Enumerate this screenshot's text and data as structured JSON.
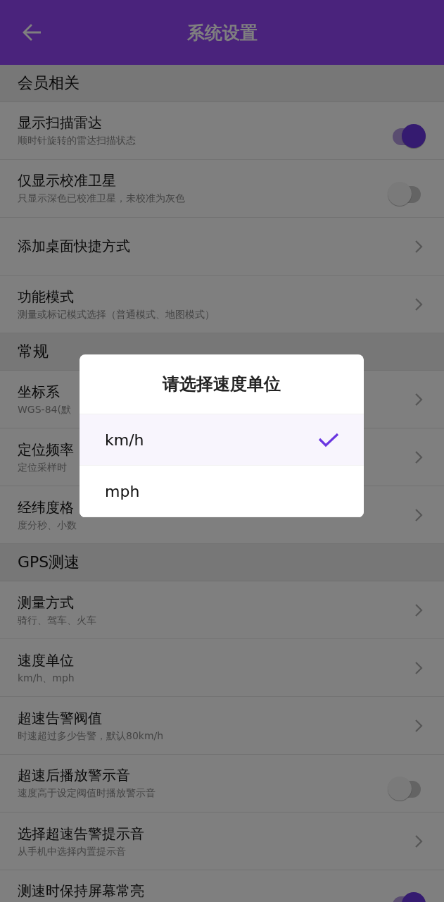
{
  "header": {
    "title": "系统设置"
  },
  "sections": [
    {
      "title": "会员相关",
      "items": [
        {
          "kind": "toggle",
          "title": "显示扫描雷达",
          "subtitle": "顺时针旋转的雷达扫描状态",
          "on": true
        },
        {
          "kind": "toggle",
          "title": "仅显示校准卫星",
          "subtitle": "只显示深色已校准卫星，未校准为灰色",
          "on": false
        },
        {
          "kind": "link",
          "title": "添加桌面快捷方式"
        },
        {
          "kind": "link",
          "title": "功能模式",
          "subtitle": "测量或标记模式选择（普通模式、地图模式）"
        }
      ]
    },
    {
      "title": "常规",
      "items": [
        {
          "kind": "link",
          "title": "坐标系",
          "subtitle": "WGS-84(默"
        },
        {
          "kind": "link",
          "title": "定位频率",
          "subtitle": "定位采样时"
        },
        {
          "kind": "link",
          "title": "经纬度格",
          "subtitle": "度分秒、小数"
        }
      ]
    },
    {
      "title": "GPS测速",
      "items": [
        {
          "kind": "link",
          "title": "测量方式",
          "subtitle": "骑行、驾车、火车"
        },
        {
          "kind": "link",
          "title": "速度单位",
          "subtitle": "km/h、mph"
        },
        {
          "kind": "link",
          "title": "超速告警阀值",
          "subtitle": "时速超过多少告警，默认80km/h"
        },
        {
          "kind": "toggle",
          "title": "超速后播放警示音",
          "subtitle": "速度高于设定阀值时播放警示音",
          "on": false
        },
        {
          "kind": "link",
          "title": "选择超速告警提示音",
          "subtitle": "从手机中选择内置提示音"
        },
        {
          "kind": "toggle",
          "title": "测速时保持屏幕常亮",
          "on": true
        }
      ]
    }
  ],
  "dialog": {
    "title": "请选择速度单位",
    "options": [
      {
        "label": "km/h",
        "selected": true
      },
      {
        "label": "mph",
        "selected": false
      }
    ]
  }
}
